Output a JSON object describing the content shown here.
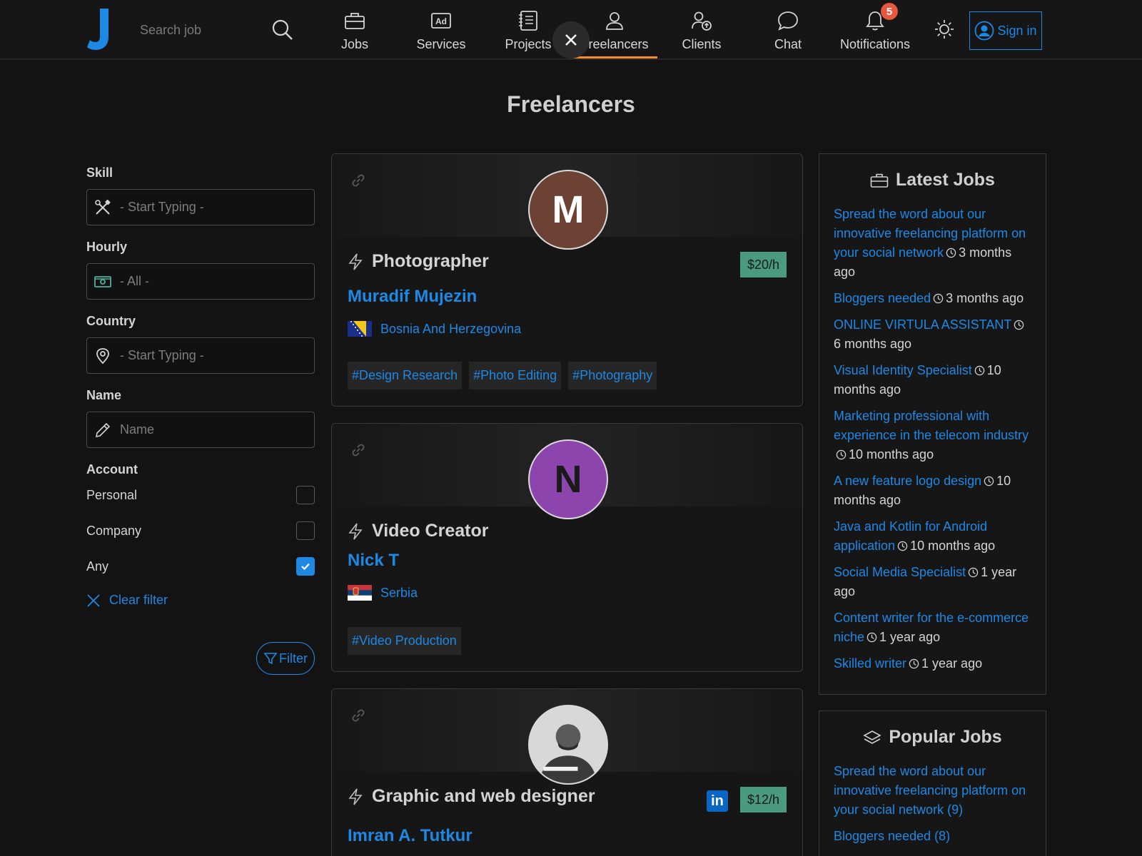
{
  "navbar": {
    "logo_letter": "J",
    "search_placeholder": "Search job",
    "items": [
      {
        "label": "Jobs",
        "icon": "briefcase-icon"
      },
      {
        "label": "Services",
        "icon": "ad-icon"
      },
      {
        "label": "Projects",
        "icon": "notebook-icon"
      },
      {
        "label": "Freelancers",
        "icon": "person-icon",
        "active": true
      },
      {
        "label": "Clients",
        "icon": "person-arrow-icon"
      },
      {
        "label": "Chat",
        "icon": "chat-bubble-icon"
      },
      {
        "label": "Notifications",
        "icon": "bell-icon",
        "badge": "5"
      }
    ],
    "signin_label": "Sign in"
  },
  "page_title": "Freelancers",
  "filters": {
    "skill_label": "Skill",
    "skill_placeholder": "- Start Typing -",
    "hourly_label": "Hourly",
    "hourly_placeholder": "- All -",
    "country_label": "Country",
    "country_placeholder": "- Start Typing -",
    "name_label": "Name",
    "name_placeholder": "Name",
    "account_label": "Account",
    "account_options": [
      {
        "label": "Personal",
        "checked": false
      },
      {
        "label": "Company",
        "checked": false
      },
      {
        "label": "Any",
        "checked": true
      }
    ],
    "clear_label": "Clear filter",
    "filter_label": "Filter"
  },
  "freelancers": [
    {
      "initial": "M",
      "avatar_color": "#6b4234",
      "profession": "Photographer",
      "rate": "$20/h",
      "name": "Muradif Mujezin",
      "country": "Bosnia And Herzegovina",
      "tags": [
        "#Design Research",
        "#Photo Editing",
        "#Photography"
      ]
    },
    {
      "initial": "N",
      "avatar_color": "#8e44ad",
      "profession": "Video Creator",
      "name": "Nick T",
      "country": "Serbia",
      "tags": [
        "#Video Production"
      ]
    },
    {
      "profession": "Graphic and web designer",
      "rate": "$12/h",
      "linkedin": "in",
      "name": "Imran A. Tutkur"
    }
  ],
  "latest_jobs": {
    "title": "Latest Jobs",
    "items": [
      {
        "title": "Spread the word about our innovative freelancing platform on your social network",
        "time": "3 months ago"
      },
      {
        "title": "Bloggers needed",
        "time": "3 months ago"
      },
      {
        "title": "ONLINE VIRTULA ASSISTANT",
        "time": "6 months ago"
      },
      {
        "title": "Visual Identity Specialist",
        "time": "10 months ago"
      },
      {
        "title": "Marketing professional with experience in the telecom industry",
        "time": "10 months ago"
      },
      {
        "title": "A new feature logo design",
        "time": "10 months ago"
      },
      {
        "title": "Java and Kotlin for Android application",
        "time": "10 months ago"
      },
      {
        "title": "Social Media Specialist",
        "time": "1 year ago"
      },
      {
        "title": "Content writer for the e-commerce niche",
        "time": "1 year ago"
      },
      {
        "title": "Skilled writer",
        "time": "1 year ago"
      }
    ]
  },
  "popular_jobs": {
    "title": "Popular Jobs",
    "items": [
      {
        "title": "Spread the word about our innovative freelancing platform on your social network",
        "count": "(9)"
      },
      {
        "title": "Bloggers needed",
        "count": "(8)"
      }
    ]
  },
  "colors": {
    "accent": "#1e88e5",
    "active_tab": "#f28c28",
    "rate_badge": "#4a9a7f",
    "notification_badge": "#e8573f"
  }
}
